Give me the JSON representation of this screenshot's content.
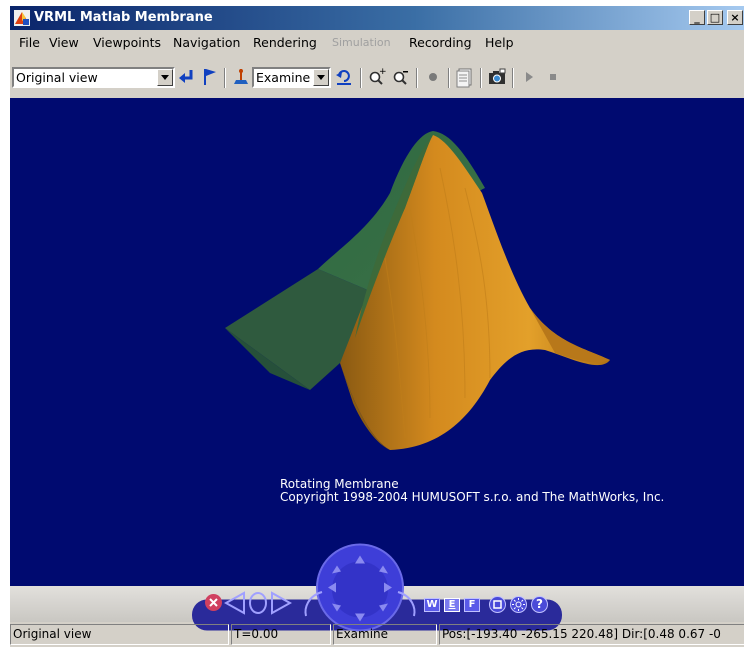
{
  "window": {
    "title": "VRML Matlab Membrane",
    "minimize_label": "_",
    "maximize_label": "□",
    "close_label": "×"
  },
  "menu": {
    "items": [
      "File",
      "View",
      "Viewpoints",
      "Navigation",
      "Rendering",
      "Simulation",
      "Recording",
      "Help"
    ],
    "disabled": [
      "Simulation"
    ]
  },
  "toolbar": {
    "viewpoint_value": "Original view",
    "nav_mode_value": "Examine"
  },
  "scene": {
    "caption_line1": "Rotating Membrane",
    "caption_line2": "Copyright 1998-2004 HUMUSOFT s.r.o. and The MathWorks, Inc.",
    "background_color": "#000a70",
    "surface_color": "#d9901f",
    "surface_shadow_color": "#2e5a3a"
  },
  "navpanel": {
    "walk_label": "W",
    "examine_label": "E",
    "fly_label": "F",
    "help_label": "?"
  },
  "status": {
    "viewpoint": "Original view",
    "time": "T=0.00",
    "mode": "Examine",
    "position": "Pos:[-193.40 -265.15 220.48] Dir:[0.48 0.67 -0"
  }
}
